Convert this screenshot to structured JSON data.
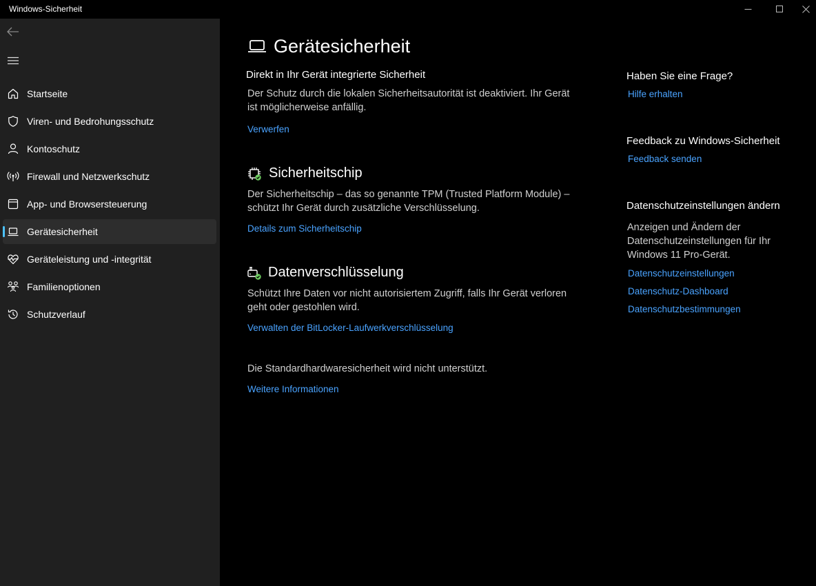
{
  "window": {
    "title": "Windows-Sicherheit"
  },
  "colors": {
    "accent": "#4cc2ff",
    "link": "#4aa3ff",
    "sidebar_bg": "#202020",
    "main_bg": "#000000",
    "ok_green": "#6ccb5f"
  },
  "sidebar": {
    "items": [
      {
        "label": "Startseite",
        "icon": "home-icon"
      },
      {
        "label": "Viren- und Bedrohungsschutz",
        "icon": "shield-icon"
      },
      {
        "label": "Kontoschutz",
        "icon": "person-icon"
      },
      {
        "label": "Firewall und Netzwerkschutz",
        "icon": "antenna-icon"
      },
      {
        "label": "App- und Browsersteuerung",
        "icon": "browser-window-icon"
      },
      {
        "label": "Gerätesicherheit",
        "icon": "laptop-icon",
        "active": true
      },
      {
        "label": "Geräteleistung und -integrität",
        "icon": "heart-pulse-icon"
      },
      {
        "label": "Familienoptionen",
        "icon": "family-icon"
      },
      {
        "label": "Schutzverlauf",
        "icon": "history-icon"
      }
    ]
  },
  "main": {
    "title": "Gerätesicherheit",
    "core": {
      "heading": "Direkt in Ihr Gerät integrierte Sicherheit",
      "text_line1": "Der Schutz durch die lokalen Sicherheitsautorität ist deaktiviert. Ihr Gerät",
      "text_line2": "ist möglicherweise anfällig.",
      "link": "Verwerfen"
    },
    "chip": {
      "heading": "Sicherheitschip",
      "text_line1": "Der Sicherheitschip – das so genannte TPM (Trusted Platform Module) –",
      "text_line2": "schützt Ihr Gerät durch zusätzliche Verschlüsselung.",
      "link": "Details zum Sicherheitschip"
    },
    "encryption": {
      "heading": "Datenverschlüsselung",
      "text_line1": "Schützt Ihre Daten vor nicht autorisiertem Zugriff, falls Ihr Gerät verloren",
      "text_line2": "geht oder gestohlen wird.",
      "link": "Verwalten der BitLocker-Laufwerkverschlüsselung"
    },
    "hardware": {
      "text": "Die Standardhardwaresicherheit wird nicht unterstützt.",
      "link": "Weitere Informationen"
    }
  },
  "right": {
    "question": {
      "heading": "Haben Sie eine Frage?",
      "link": "Hilfe erhalten"
    },
    "feedback": {
      "heading": "Feedback zu Windows-Sicherheit",
      "link": "Feedback senden"
    },
    "privacy": {
      "heading": "Datenschutzeinstellungen ändern",
      "text_line1": "Anzeigen und Ändern der",
      "text_line2": "Datenschutzeinstellungen für Ihr",
      "text_line3": "Windows 11 Pro-Gerät.",
      "links": [
        "Datenschutzeinstellungen",
        "Datenschutz-Dashboard",
        "Datenschutzbestimmungen"
      ]
    }
  }
}
